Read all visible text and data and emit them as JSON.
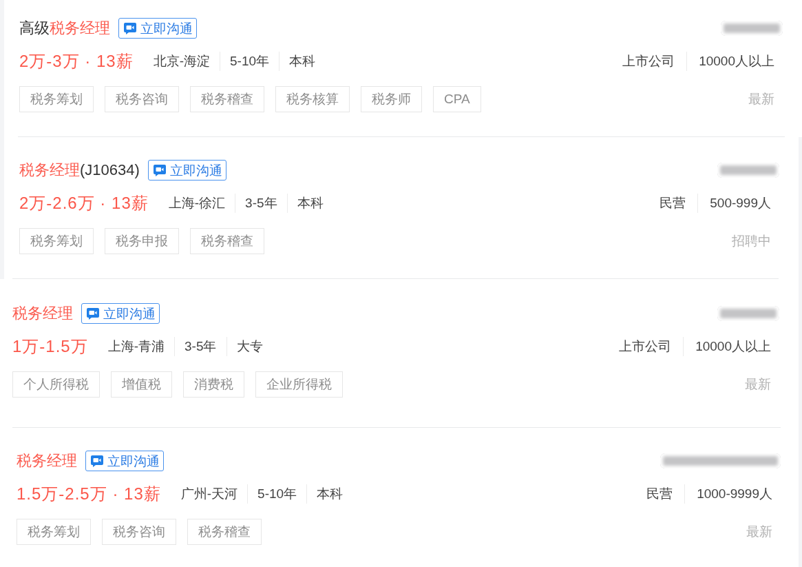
{
  "jobs": [
    {
      "title": [
        {
          "text": "高级",
          "highlighted": false
        },
        {
          "text": "税务经理",
          "highlighted": true
        }
      ],
      "chat_button": "立即沟通",
      "salary": "2万-3万 · 13薪",
      "location": "北京-海淀",
      "experience": "5-10年",
      "education": "本科",
      "tags": [
        "税务筹划",
        "税务咨询",
        "税务稽查",
        "税务核算",
        "税务师",
        "CPA"
      ],
      "company_type": "上市公司",
      "company_size": "10000人以上",
      "status": "最新"
    },
    {
      "title": [
        {
          "text": "税务经理",
          "highlighted": true
        },
        {
          "text": "(J10634)",
          "highlighted": false
        }
      ],
      "chat_button": "立即沟通",
      "salary": "2万-2.6万 · 13薪",
      "location": "上海-徐汇",
      "experience": "3-5年",
      "education": "本科",
      "tags": [
        "税务筹划",
        "税务申报",
        "税务稽查"
      ],
      "company_type": "民营",
      "company_size": "500-999人",
      "status": "招聘中"
    },
    {
      "title": [
        {
          "text": "税务经理",
          "highlighted": true
        }
      ],
      "chat_button": "立即沟通",
      "salary": "1万-1.5万",
      "location": "上海-青浦",
      "experience": "3-5年",
      "education": "大专",
      "tags": [
        "个人所得税",
        "增值税",
        "消费税",
        "企业所得税"
      ],
      "company_type": "上市公司",
      "company_size": "10000人以上",
      "status": "最新"
    },
    {
      "title": [
        {
          "text": "税务经理",
          "highlighted": true
        }
      ],
      "chat_button": "立即沟通",
      "salary": "1.5万-2.5万 · 13薪",
      "location": "广州-天河",
      "experience": "5-10年",
      "education": "本科",
      "tags": [
        "税务筹划",
        "税务咨询",
        "税务稽查"
      ],
      "company_type": "民营",
      "company_size": "1000-9999人",
      "status": "最新"
    }
  ]
}
